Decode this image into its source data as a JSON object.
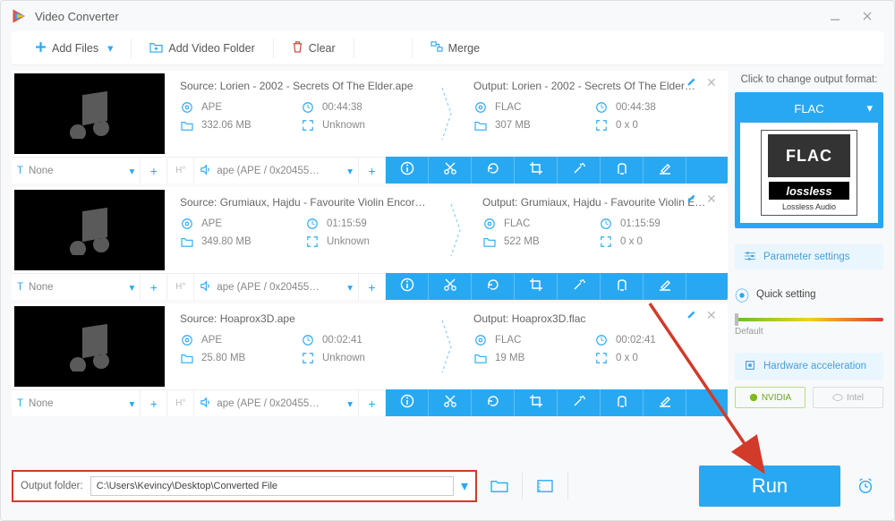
{
  "app_title": "Video Converter",
  "toolbar": {
    "add_files": "Add Files",
    "add_video_folder": "Add Video Folder",
    "clear": "Clear",
    "merge": "Merge"
  },
  "items": [
    {
      "source": {
        "title": "Source: Lorien - 2002 - Secrets Of The Elder.ape",
        "codec": "APE",
        "duration": "00:44:38",
        "size": "332.06 MB",
        "dimensions": "Unknown"
      },
      "output": {
        "title": "Output: Lorien - 2002 - Secrets Of The Elder…",
        "codec": "FLAC",
        "duration": "00:44:38",
        "size": "307 MB",
        "dimensions": "0 x 0"
      },
      "subtitle": "None",
      "audio_track": "ape (APE / 0x20455…"
    },
    {
      "source": {
        "title": "Source: Grumiaux, Hajdu - Favourite Violin Encore…",
        "codec": "APE",
        "duration": "01:15:59",
        "size": "349.80 MB",
        "dimensions": "Unknown"
      },
      "output": {
        "title": "Output: Grumiaux, Hajdu - Favourite Violin E…",
        "codec": "FLAC",
        "duration": "01:15:59",
        "size": "522 MB",
        "dimensions": "0 x 0"
      },
      "subtitle": "None",
      "audio_track": "ape (APE / 0x20455…"
    },
    {
      "source": {
        "title": "Source: Hoaprox3D.ape",
        "codec": "APE",
        "duration": "00:02:41",
        "size": "25.80 MB",
        "dimensions": "Unknown"
      },
      "output": {
        "title": "Output: Hoaprox3D.flac",
        "codec": "FLAC",
        "duration": "00:02:41",
        "size": "19 MB",
        "dimensions": "0 x 0"
      },
      "subtitle": "None",
      "audio_track": "ape (APE / 0x20455…"
    }
  ],
  "sidebar": {
    "change_label": "Click to change output format:",
    "format": "FLAC",
    "tile_top": "FLAC",
    "tile_mid": "lossless",
    "tile_sub": "Lossless Audio",
    "param_settings": "Parameter settings",
    "quick_setting": "Quick setting",
    "slider_label": "Default",
    "hardware_accel": "Hardware acceleration",
    "gpu_nvidia": "NVIDIA",
    "gpu_intel": "Intel"
  },
  "bottom": {
    "output_folder_label": "Output folder:",
    "output_folder_value": "C:\\Users\\Kevincy\\Desktop\\Converted File",
    "run": "Run"
  }
}
